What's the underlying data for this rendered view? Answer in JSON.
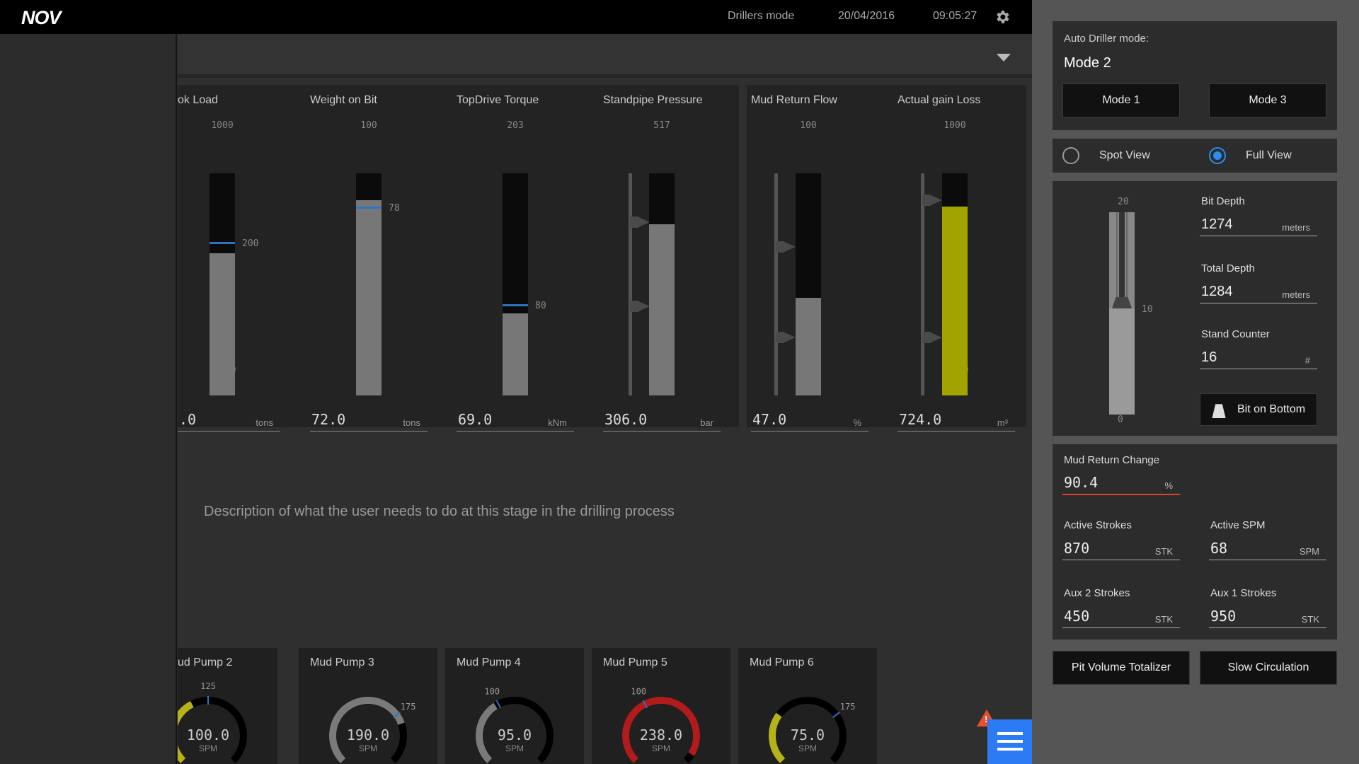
{
  "header": {
    "logo": "NOV",
    "mode": "Drillers mode",
    "date": "20/04/2016",
    "time": "09:05:27"
  },
  "gauges": [
    {
      "title": "ok Load",
      "max": "1000",
      "min": "-1000",
      "marker_label": "200",
      "value": ".0",
      "unit": "tons",
      "fill_fraction": 0.64,
      "marker_fraction": 0.68
    },
    {
      "title": "Weight on Bit",
      "max": "100",
      "min": "-100",
      "marker_label": "78",
      "value": "72.0",
      "unit": "tons",
      "fill_fraction": 0.88,
      "marker_fraction": 0.84
    },
    {
      "title": "TopDrive Torque",
      "max": "203",
      "min": "0",
      "marker_label": "80",
      "value": "69.0",
      "unit": "kNm",
      "fill_fraction": 0.37,
      "marker_fraction": 0.4
    },
    {
      "title": "Standpipe Pressure",
      "max": "517",
      "min": "0",
      "value": "306.0",
      "unit": "bar",
      "fill_fraction": 0.77
    },
    {
      "title": "Mud Return Flow",
      "max": "100",
      "min": "0",
      "value": "47.0",
      "unit": "%",
      "fill_fraction": 0.44
    },
    {
      "title": "Actual gain Loss",
      "max": "1000",
      "min": "-1000",
      "value": "724.0",
      "unit": "m³",
      "fill_fraction": 0.85
    }
  ],
  "description": "Description of what the user needs to do at this stage in the drilling process",
  "pumps": [
    {
      "title": "ud Pump 2",
      "value": "100.0",
      "unit": "SPM",
      "min": "0",
      "max": "250",
      "mark": "125",
      "fraction": 0.4,
      "color": "#b5b319"
    },
    {
      "title": "Mud Pump 3",
      "value": "190.0",
      "unit": "SPM",
      "min": "0",
      "max": "250",
      "mark": "175",
      "fraction": 0.76,
      "color": "#7a7a7a"
    },
    {
      "title": "Mud Pump 4",
      "value": "95.0",
      "unit": "SPM",
      "min": "0",
      "max": "250",
      "mark": "100",
      "fraction": 0.38,
      "color": "#7a7a7a"
    },
    {
      "title": "Mud Pump 5",
      "value": "238.0",
      "unit": "SPM",
      "min": "0",
      "max": "250",
      "mark": "100",
      "fraction": 0.95,
      "color": "#b01c1c"
    },
    {
      "title": "Mud Pump 6",
      "value": "75.0",
      "unit": "SPM",
      "min": "0",
      "max": "250",
      "mark": "175",
      "fraction": 0.3,
      "color": "#b5b319"
    }
  ],
  "right": {
    "auto_driller_label": "Auto Driller mode:",
    "auto_driller_value": "Mode 2",
    "mode1": "Mode 1",
    "mode3": "Mode 3",
    "spot_view": "Spot View",
    "full_view": "Full View",
    "well_scale": {
      "top": "20",
      "mid": "10",
      "bottom": "0"
    },
    "bit_depth": {
      "label": "Bit Depth",
      "value": "1274",
      "unit": "meters"
    },
    "total_depth": {
      "label": "Total Depth",
      "value": "1284",
      "unit": "meters"
    },
    "stand_counter": {
      "label": "Stand Counter",
      "value": "16",
      "unit": "#"
    },
    "bit_on_bottom": "Bit on Bottom",
    "mud_return_change": {
      "label": "Mud Return Change",
      "value": "90.4",
      "unit": "%"
    },
    "active_strokes": {
      "label": "Active Strokes",
      "value": "870",
      "unit": "STK"
    },
    "active_spm": {
      "label": "Active SPM",
      "value": "68",
      "unit": "SPM"
    },
    "aux2": {
      "label": "Aux 2 Strokes",
      "value": "450",
      "unit": "STK"
    },
    "aux1": {
      "label": "Aux 1 Strokes",
      "value": "950",
      "unit": "STK"
    },
    "pit_volume": "Pit Volume Totalizer",
    "slow_circulation": "Slow Circulation"
  },
  "colors": {
    "accent": "#2d7bf4",
    "warning": "#e8502a",
    "fill_gray": "#777777",
    "fill_yellow": "#a3a300"
  }
}
